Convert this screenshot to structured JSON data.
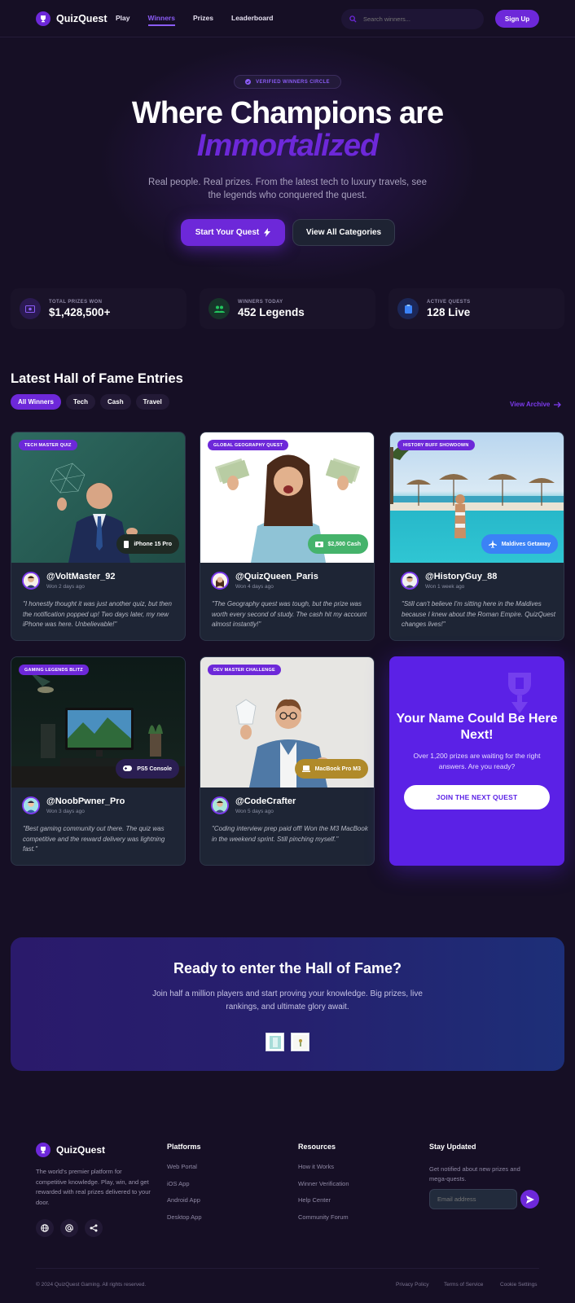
{
  "brand": {
    "name": "QuizQuest",
    "accent": "#6d28d9"
  },
  "nav": {
    "links": [
      "Play",
      "Winners",
      "Prizes",
      "Leaderboard"
    ],
    "active": "Winners",
    "search_placeholder": "Search winners...",
    "signup_label": "Sign Up"
  },
  "hero": {
    "badge": "VERIFIED WINNERS CIRCLE",
    "title_line1": "Where Champions are",
    "title_line2": "Immortalized",
    "subtitle": "Real people. Real prizes. From the latest tech to luxury travels, see the legends who conquered the quest.",
    "primary_cta": "Start Your Quest",
    "secondary_cta": "View All Categories"
  },
  "stats": [
    {
      "label": "TOTAL PRIZES WON",
      "value": "$1,428,500+",
      "icon": "cash-icon",
      "color": "#6d28d9"
    },
    {
      "label": "WINNERS TODAY",
      "value": "452 Legends",
      "icon": "users-icon",
      "color": "#22c55e"
    },
    {
      "label": "ACTIVE QUESTS",
      "value": "128 Live",
      "icon": "clipboard-icon",
      "color": "#3b82f6"
    }
  ],
  "hall": {
    "title": "Latest Hall of Fame Entries",
    "filters": [
      "All Winners",
      "Tech",
      "Cash",
      "Travel"
    ],
    "active_filter": "All Winners",
    "archive_label": "View Archive"
  },
  "cards": [
    {
      "tag": "TECH MASTER QUIZ",
      "prize": "iPhone 15 Pro",
      "prize_icon": "phone-icon",
      "user": "@VoltMaster_92",
      "won": "Won 2 days ago",
      "quote": "\"I honestly thought it was just another quiz, but then the notification popped up! Two days later, my new iPhone was here. Unbelievable!\""
    },
    {
      "tag": "GLOBAL GEOGRAPHY QUEST",
      "prize": "$2,500 Cash",
      "prize_icon": "cash-icon",
      "user": "@QuizQueen_Paris",
      "won": "Won 4 days ago",
      "quote": "\"The Geography quest was tough, but the prize was worth every second of study. The cash hit my account almost instantly!\""
    },
    {
      "tag": "HISTORY BUFF SHOWDOWN",
      "prize": "Maldives Getaway",
      "prize_icon": "plane-icon",
      "user": "@HistoryGuy_88",
      "won": "Won 1 week ago",
      "quote": "\"Still can't believe I'm sitting here in the Maldives because I knew about the Roman Empire. QuizQuest changes lives!\""
    },
    {
      "tag": "GAMING LEGENDS BLITZ",
      "prize": "PS5 Console",
      "prize_icon": "gamepad-icon",
      "user": "@NoobPwner_Pro",
      "won": "Won 3 days ago",
      "quote": "\"Best gaming community out there. The quiz was competitive and the reward delivery was lightning fast.\""
    },
    {
      "tag": "DEV MASTER CHALLENGE",
      "prize": "MacBook Pro M3",
      "prize_icon": "laptop-icon",
      "user": "@CodeCrafter",
      "won": "Won 5 days ago",
      "quote": "\"Coding interview prep paid off! Won the M3 MacBook in the weekend sprint. Still pinching myself.\""
    }
  ],
  "cta_card": {
    "title": "Your Name Could Be Here Next!",
    "subtitle": "Over 1,200 prizes are waiting for the right answers. Are you ready?",
    "button": "JOIN THE NEXT QUEST"
  },
  "banner": {
    "title": "Ready to enter the Hall of Fame?",
    "subtitle": "Join half a million players and start proving your knowledge. Big prizes, live rankings, and ultimate glory await."
  },
  "footer": {
    "description": "The world's premier platform for competitive knowledge. Play, win, and get rewarded with real prizes delivered to your door.",
    "platforms": {
      "title": "Platforms",
      "links": [
        "Web Portal",
        "iOS App",
        "Android App",
        "Desktop App"
      ]
    },
    "resources": {
      "title": "Resources",
      "links": [
        "How it Works",
        "Winner Verification",
        "Help Center",
        "Community Forum"
      ]
    },
    "updates": {
      "title": "Stay Updated",
      "text": "Get notified about new prizes and mega-quests.",
      "email_placeholder": "Email address"
    },
    "copyright": "© 2024 QuizQuest Gaming. All rights reserved.",
    "legal": [
      "Privacy Policy",
      "Terms of Service",
      "Cookie Settings"
    ]
  }
}
